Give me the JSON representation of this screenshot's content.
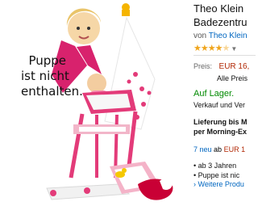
{
  "product": {
    "title_line1": "Theo Klein",
    "title_line2": "Badezentru",
    "byline_prefix": "von",
    "brand": "Theo Klein",
    "rating_stars": 4.5,
    "caption_lines": [
      "Puppe",
      "ist nicht",
      "enthalten."
    ]
  },
  "pricing": {
    "price_label": "Preis:",
    "price_value": "EUR 16,",
    "tax_note": "Alle Preis"
  },
  "availability": {
    "status": "Auf Lager.",
    "seller": "Verkauf und Ver",
    "delivery_line1": "Lieferung bis M",
    "delivery_line2": "per Morning-Ex"
  },
  "offers": {
    "new_text": "7 neu",
    "ab_text": "ab",
    "price_text": "EUR 1"
  },
  "features": {
    "bullets": [
      "ab 3 Jahren",
      "Puppe ist nic"
    ],
    "more_link": "Weitere Produ"
  },
  "colors": {
    "price": "#b12704",
    "link": "#0066c0",
    "stock": "#008a00",
    "star": "#f0a51c",
    "pink": "#d8226d"
  }
}
